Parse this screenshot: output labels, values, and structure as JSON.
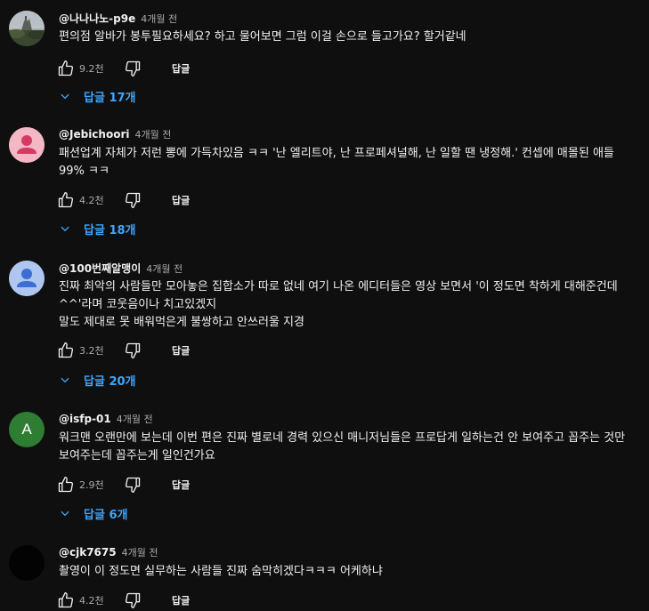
{
  "reply_label": "답글",
  "comments": [
    {
      "author": "@나나나노-p9e",
      "time": "4개월 전",
      "text": "편의점 알바가 봉투필요하세요? 하고 물어보면 그럼 이걸 손으로 들고가요? 할거같네",
      "likes": "9.2천",
      "replies": "답글 17개",
      "avatar": "landscape-photo"
    },
    {
      "author": "@Jebichoori",
      "time": "4개월 전",
      "text": "패션업계 자체가 저런 뽕에 가득차있음 ㅋㅋ '난 엘리트야, 난 프로페셔널해, 난 일할 땐 냉정해.' 컨셉에 매몰된 애들 99% ㅋㅋ",
      "likes": "4.2천",
      "replies": "답글 18개",
      "avatar": "default-user-pink"
    },
    {
      "author": "@100번째알맹이",
      "time": "4개월 전",
      "text": "진짜 최악의 사람들만 모아놓은 집합소가 따로 없네 여기 나온 에디터들은 영상 보면서 '이 정도면 착하게 대해준건데^^'라며 코웃음이나 치고있겠지\n말도 제대로 못 배워먹은게 불쌍하고 안쓰러울 지경",
      "likes": "3.2천",
      "replies": "답글 20개",
      "avatar": "default-user-blue"
    },
    {
      "author": "@isfp-01",
      "time": "4개월 전",
      "text": "워크맨 오랜만에 보는데 이번 편은 진짜 별로네 경력 있으신 매니저님들은 프로답게 일하는건 안 보여주고 꼽주는 것만 보여주는데 꼽주는게 일인건가요",
      "likes": "2.9천",
      "replies": "답글 6개",
      "avatar": "letter-A",
      "avatar_letter": "A"
    },
    {
      "author": "@cjk7675",
      "time": "4개월 전",
      "text": "촬영이 이 정도면 실무하는 사람들 진짜 숨막히겠다ㅋㅋㅋ 어케하냐",
      "likes": "4.2천",
      "replies": "",
      "avatar": "black-circle"
    }
  ]
}
